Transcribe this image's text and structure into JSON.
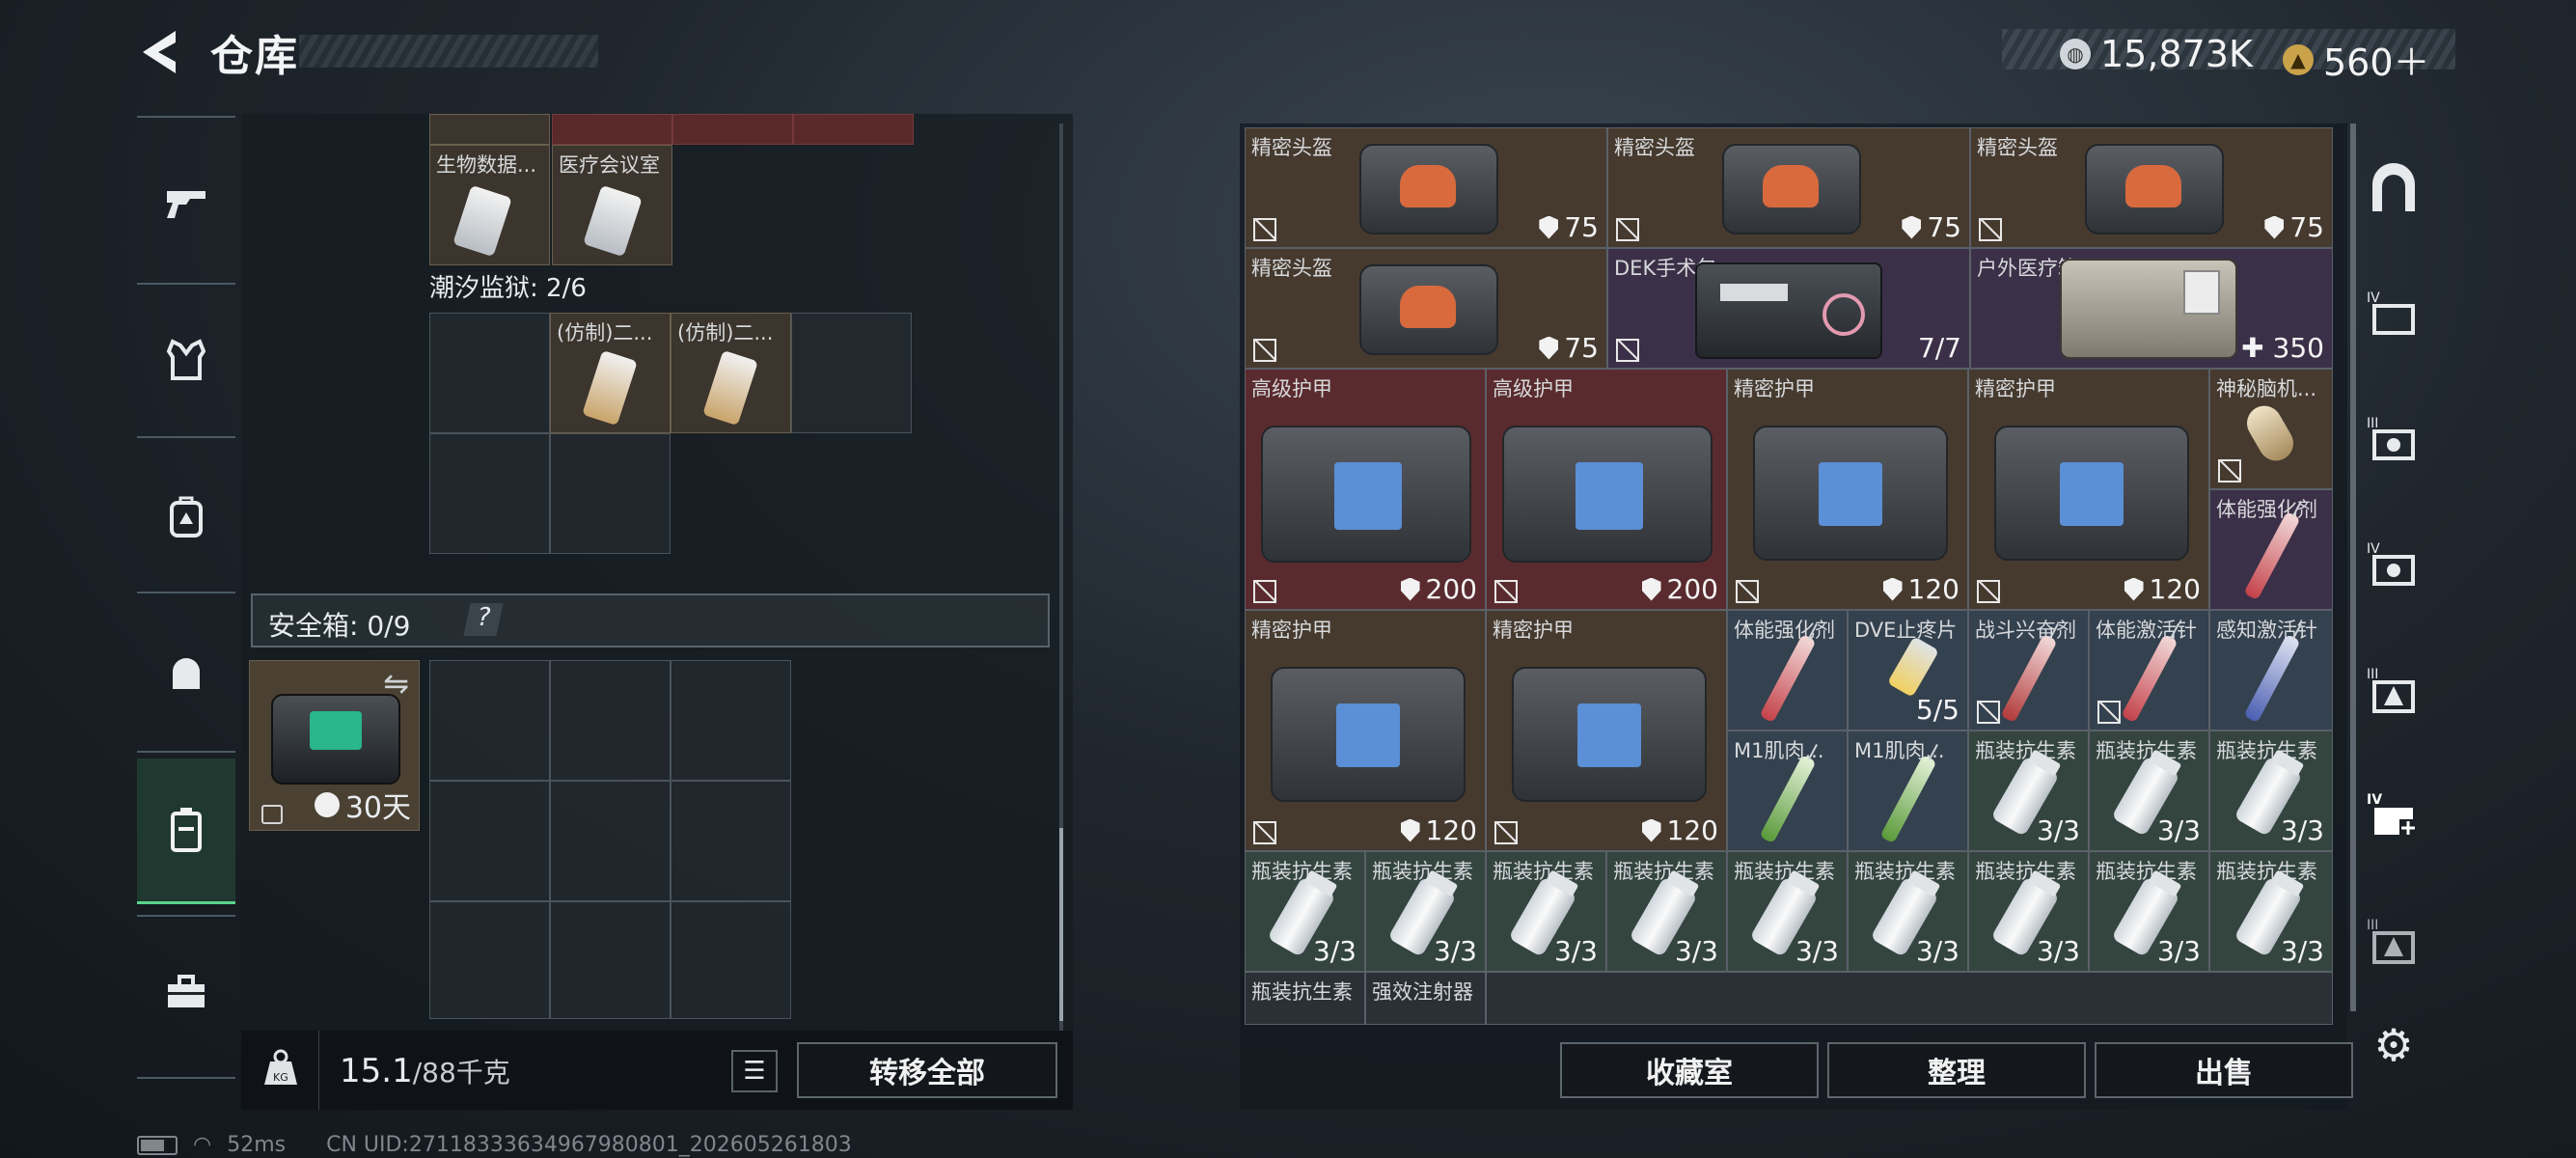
{
  "header": {
    "title": "仓库",
    "currency": [
      {
        "icon": "coin-icon",
        "value": "15,873K"
      },
      {
        "icon": "gold-triangle-icon",
        "value": "560＋"
      }
    ]
  },
  "left_nav": {
    "items": [
      "gun-icon",
      "armor-vest-icon",
      "backpack-icon",
      "helmet-bag-icon",
      "safebox-icon",
      "toolbox-icon"
    ],
    "active_index": 4
  },
  "left_panel": {
    "top_items": [
      "生物数据...",
      "医疗会议室"
    ],
    "prison_section": {
      "label": "潮汐监狱: 2/6",
      "items": [
        "(仿制)二...",
        "(仿制)二..."
      ]
    },
    "safebox": {
      "label": "安全箱: 0/9",
      "help": "?",
      "timer": "30天"
    }
  },
  "bottom_bar": {
    "weight_value": "15.1",
    "weight_total": "/88千克",
    "transfer_all": "转移全部"
  },
  "right_grid": {
    "helmets": [
      {
        "name": "精密头盔",
        "armor": "75"
      },
      {
        "name": "精密头盔",
        "armor": "75"
      },
      {
        "name": "精密头盔",
        "armor": "75"
      },
      {
        "name": "精密头盔",
        "armor": "75"
      }
    ],
    "dek_kit": {
      "name": "DEK手术包",
      "qty": "7/7"
    },
    "outdoor_kit": {
      "name": "户外医疗箱",
      "qty": "350"
    },
    "advanced_armor": [
      {
        "name": "高级护甲",
        "armor": "200"
      },
      {
        "name": "高级护甲",
        "armor": "200"
      }
    ],
    "precision_armor": [
      {
        "name": "精密护甲",
        "armor": "120"
      },
      {
        "name": "精密护甲",
        "armor": "120"
      },
      {
        "name": "精密护甲",
        "armor": "120"
      },
      {
        "name": "精密护甲",
        "armor": "120"
      }
    ],
    "brain_item": "神秘脑机...",
    "stamina_booster": "体能强化剂",
    "row5_small": [
      {
        "name": "体能强化剂",
        "qty": ""
      },
      {
        "name": "DVE止疼片",
        "qty": "5/5"
      },
      {
        "name": "战斗兴奋剂",
        "qty": ""
      },
      {
        "name": "体能激活针",
        "qty": ""
      },
      {
        "name": "感知激活针",
        "qty": ""
      }
    ],
    "row6_small": [
      {
        "name": "M1肌肉...",
        "qty": ""
      },
      {
        "name": "M1肌肉...",
        "qty": ""
      },
      {
        "name": "瓶装抗生素",
        "qty": "3/3"
      },
      {
        "name": "瓶装抗生素",
        "qty": "3/3"
      },
      {
        "name": "瓶装抗生素",
        "qty": "3/3"
      }
    ],
    "row7_small": [
      {
        "name": "瓶装抗生素",
        "qty": "3/3"
      },
      {
        "name": "瓶装抗生素",
        "qty": "3/3"
      },
      {
        "name": "瓶装抗生素",
        "qty": "3/3"
      },
      {
        "name": "瓶装抗生素",
        "qty": "3/3"
      },
      {
        "name": "瓶装抗生素",
        "qty": "3/3"
      },
      {
        "name": "瓶装抗生素",
        "qty": "3/3"
      },
      {
        "name": "瓶装抗生素",
        "qty": "3/3"
      },
      {
        "name": "瓶装抗生素",
        "qty": "3/3"
      },
      {
        "name": "瓶装抗生素",
        "qty": "3/3"
      }
    ],
    "row8_small": [
      {
        "name": "瓶装抗生素"
      },
      {
        "name": "强效注射器"
      }
    ]
  },
  "right_nav": {
    "items": [
      "safe-house-icon",
      "folder-iv-icon",
      "camera-iii-icon",
      "camera-iv-icon",
      "warning-iii-icon",
      "medkit-iv-icon",
      "warning-iii-b-icon"
    ]
  },
  "actions": {
    "collection": "收藏室",
    "sort": "整理",
    "sell": "出售"
  },
  "status_bar": {
    "ping": "52ms",
    "uid": "CN UID:27118333634967980801_202605261803"
  }
}
